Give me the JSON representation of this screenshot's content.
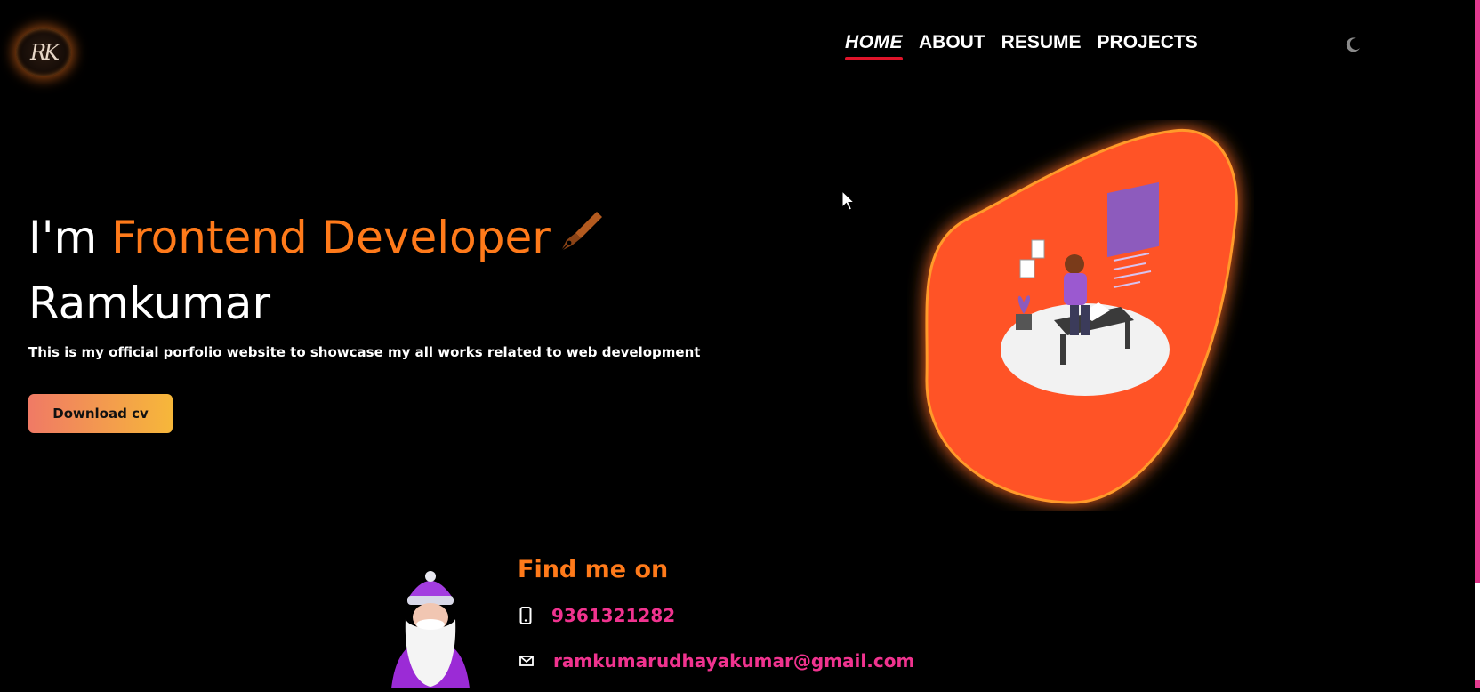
{
  "brand": {
    "logo_text": "RK"
  },
  "nav": {
    "items": [
      {
        "label": "HOME",
        "active": true
      },
      {
        "label": "ABOUT",
        "active": false
      },
      {
        "label": "RESUME",
        "active": false
      },
      {
        "label": "PROJECTS",
        "active": false
      }
    ],
    "theme_icon": "moon-icon"
  },
  "hero": {
    "prefix": "I'm ",
    "role": "Frontend Developer",
    "name": "Ramkumar",
    "description": "This is my official porfolio website to showcase my all works related to web development",
    "cv_button": "Download cv"
  },
  "contact": {
    "heading": "Find me on",
    "phone": "9361321282",
    "email": "ramkumarudhayakumar@gmail.com"
  },
  "colors": {
    "accent_orange": "#ff7a1a",
    "link_pink": "#f0338f",
    "nav_underline": "#e0142a",
    "blob": "#ff5327"
  }
}
